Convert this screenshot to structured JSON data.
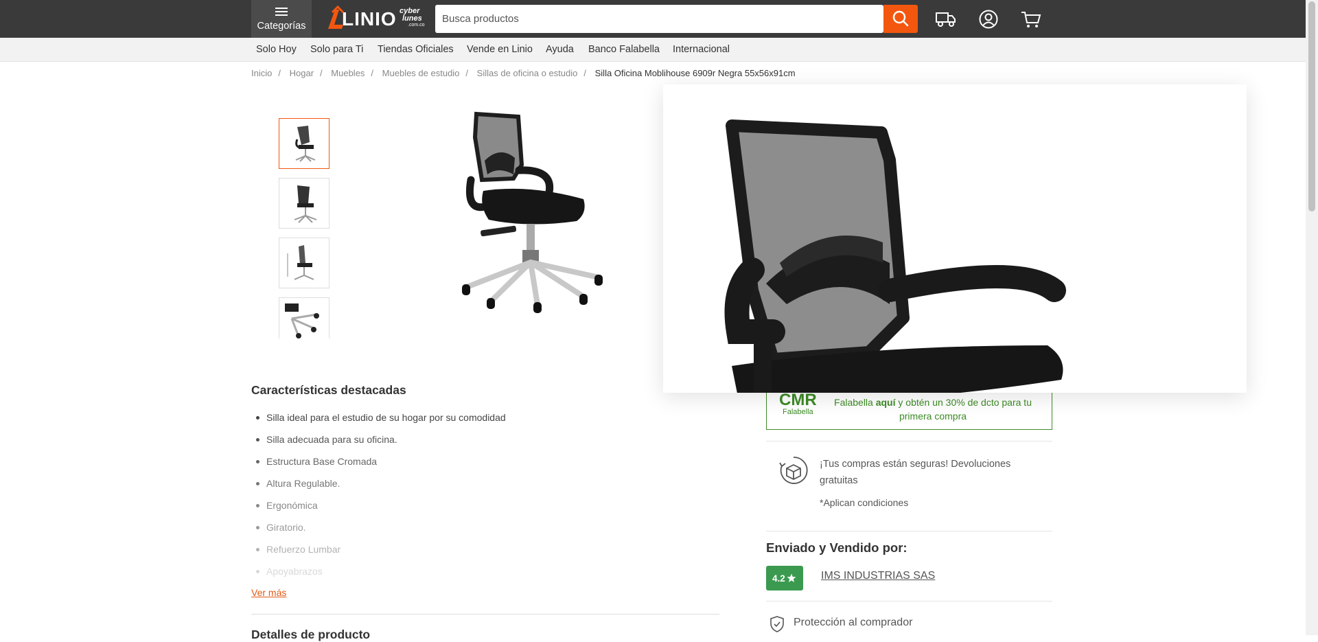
{
  "header": {
    "categories_label": "Categorías",
    "logo_text": "LINIO",
    "cyber_line1": "cyber",
    "cyber_line2": "lunes",
    "cyber_line3": ".com.co",
    "search_placeholder": "Busca productos",
    "icons": [
      "search-icon",
      "truck-icon",
      "user-icon",
      "cart-icon"
    ],
    "accent_color": "#f3570f"
  },
  "subnav": {
    "items": [
      "Solo Hoy",
      "Solo para Ti",
      "Tiendas Oficiales",
      "Vende en Linio",
      "Ayuda",
      "Banco Falabella",
      "Internacional"
    ]
  },
  "breadcrumb": {
    "items": [
      "Inicio",
      "Hogar",
      "Muebles",
      "Muebles de estudio",
      "Sillas de oficina o estudio"
    ],
    "current": "Silla Oficina Moblihouse 6909r Negra 55x56x91cm"
  },
  "features": {
    "title": "Características destacadas",
    "items": [
      "Silla ideal para el estudio de su hogar por su comodidad",
      "Silla adecuada para su oficina.",
      "Estructura Base Cromada",
      "Altura Regulable.",
      "Ergonómica",
      "Giratorio.",
      "Refuerzo Lumbar",
      "Apoyabrazos"
    ],
    "more_label": "Ver más",
    "details_title": "Detalles de producto"
  },
  "cmr": {
    "logo_main": "CMR",
    "logo_sub": "Falabella",
    "text_prefix": "Falabella ",
    "text_bold": "aquí",
    "text_suffix": " y obtén un 30% de dcto para tu primera compra",
    "color": "#3d8b26"
  },
  "secure": {
    "text": "¡Tus compras están seguras! Devoluciones gratuitas",
    "conditions": "*Aplican condiciones"
  },
  "seller": {
    "title": "Enviado y Vendido por:",
    "rating": "4.2",
    "name": "IMS INDUSTRIAS SAS",
    "protection": "Protección al comprador"
  }
}
